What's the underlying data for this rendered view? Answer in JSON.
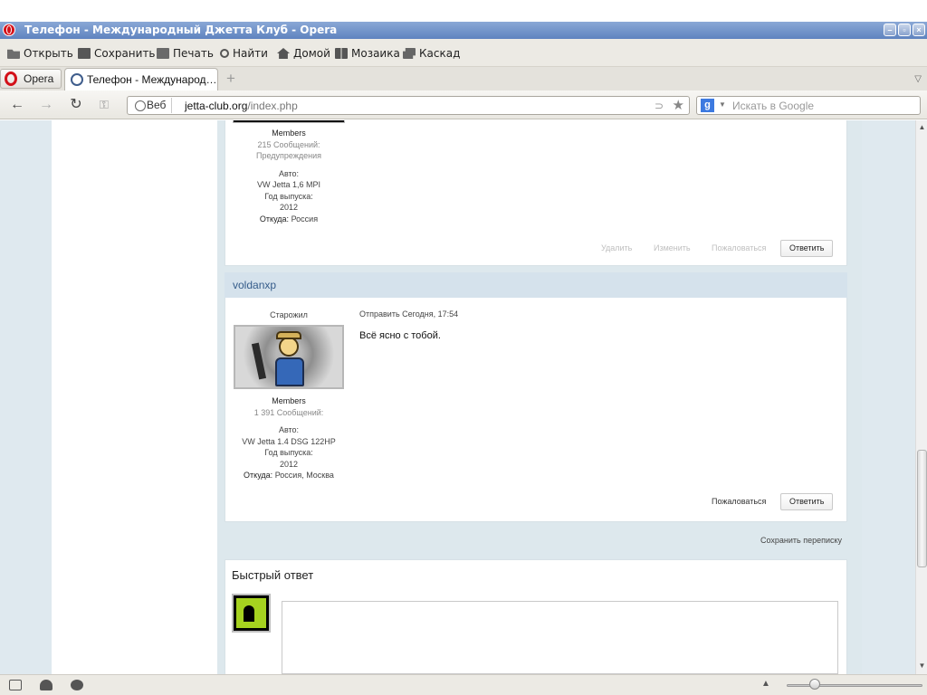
{
  "window": {
    "title": "Телефон - Международный Джетта Клуб - Opera"
  },
  "menu": {
    "open": "Открыть",
    "save": "Сохранить",
    "print": "Печать",
    "find": "Найти",
    "home": "Домой",
    "mosaic": "Мозаика",
    "cascade": "Каскад"
  },
  "tabs": {
    "opera_label": "Opera",
    "active_tab": "Телефон - Международ…"
  },
  "address": {
    "security_label": "Веб",
    "url_host": "jetta-club.org",
    "url_path": "/index.php",
    "search_placeholder": "Искать в Google",
    "search_engine": "g"
  },
  "post_prev": {
    "group": "Members",
    "posts": "215 Сообщений:",
    "warnings": "Предупреждения",
    "car_label": "Авто:",
    "car": "VW Jetta 1,6 MPI",
    "year_label": "Год выпуска:",
    "year": "2012",
    "from_label": "Откуда:",
    "from": "Россия",
    "actions": {
      "delete": "Удалить",
      "edit": "Изменить",
      "report": "Пожаловаться",
      "reply": "Ответить"
    }
  },
  "post_main": {
    "author": "voldanxp",
    "rank": "Старожил",
    "sent": "Отправить  Сегодня, 17:54",
    "message": "Всё ясно с тобой.",
    "group": "Members",
    "posts": "1 391 Сообщений:",
    "car_label": "Авто:",
    "car": "VW Jetta 1.4 DSG 122HP",
    "year_label": "Год выпуска:",
    "year": "2012",
    "from_label": "Откуда:",
    "from": "Россия, Москва",
    "actions": {
      "report": "Пожаловаться",
      "reply": "Ответить"
    }
  },
  "save_conversation": "Сохранить переписку",
  "quick_reply": {
    "title": "Быстрый ответ"
  },
  "icons": [
    "opera-logo-icon",
    "folder-icon",
    "save-icon",
    "print-icon",
    "search-icon",
    "home-icon",
    "mosaic-icon",
    "cascade-icon",
    "back-icon",
    "forward-icon",
    "reload-icon",
    "key-icon",
    "rss-icon",
    "star-icon",
    "panel-toggle-icon",
    "cloud-icon",
    "speed-icon",
    "zoom-icon"
  ],
  "colors": {
    "titlebar": "#6b8cc7",
    "name_bar": "#d5e2ec",
    "author_link": "#355c8a",
    "page_bg": "#dfe9ef"
  }
}
